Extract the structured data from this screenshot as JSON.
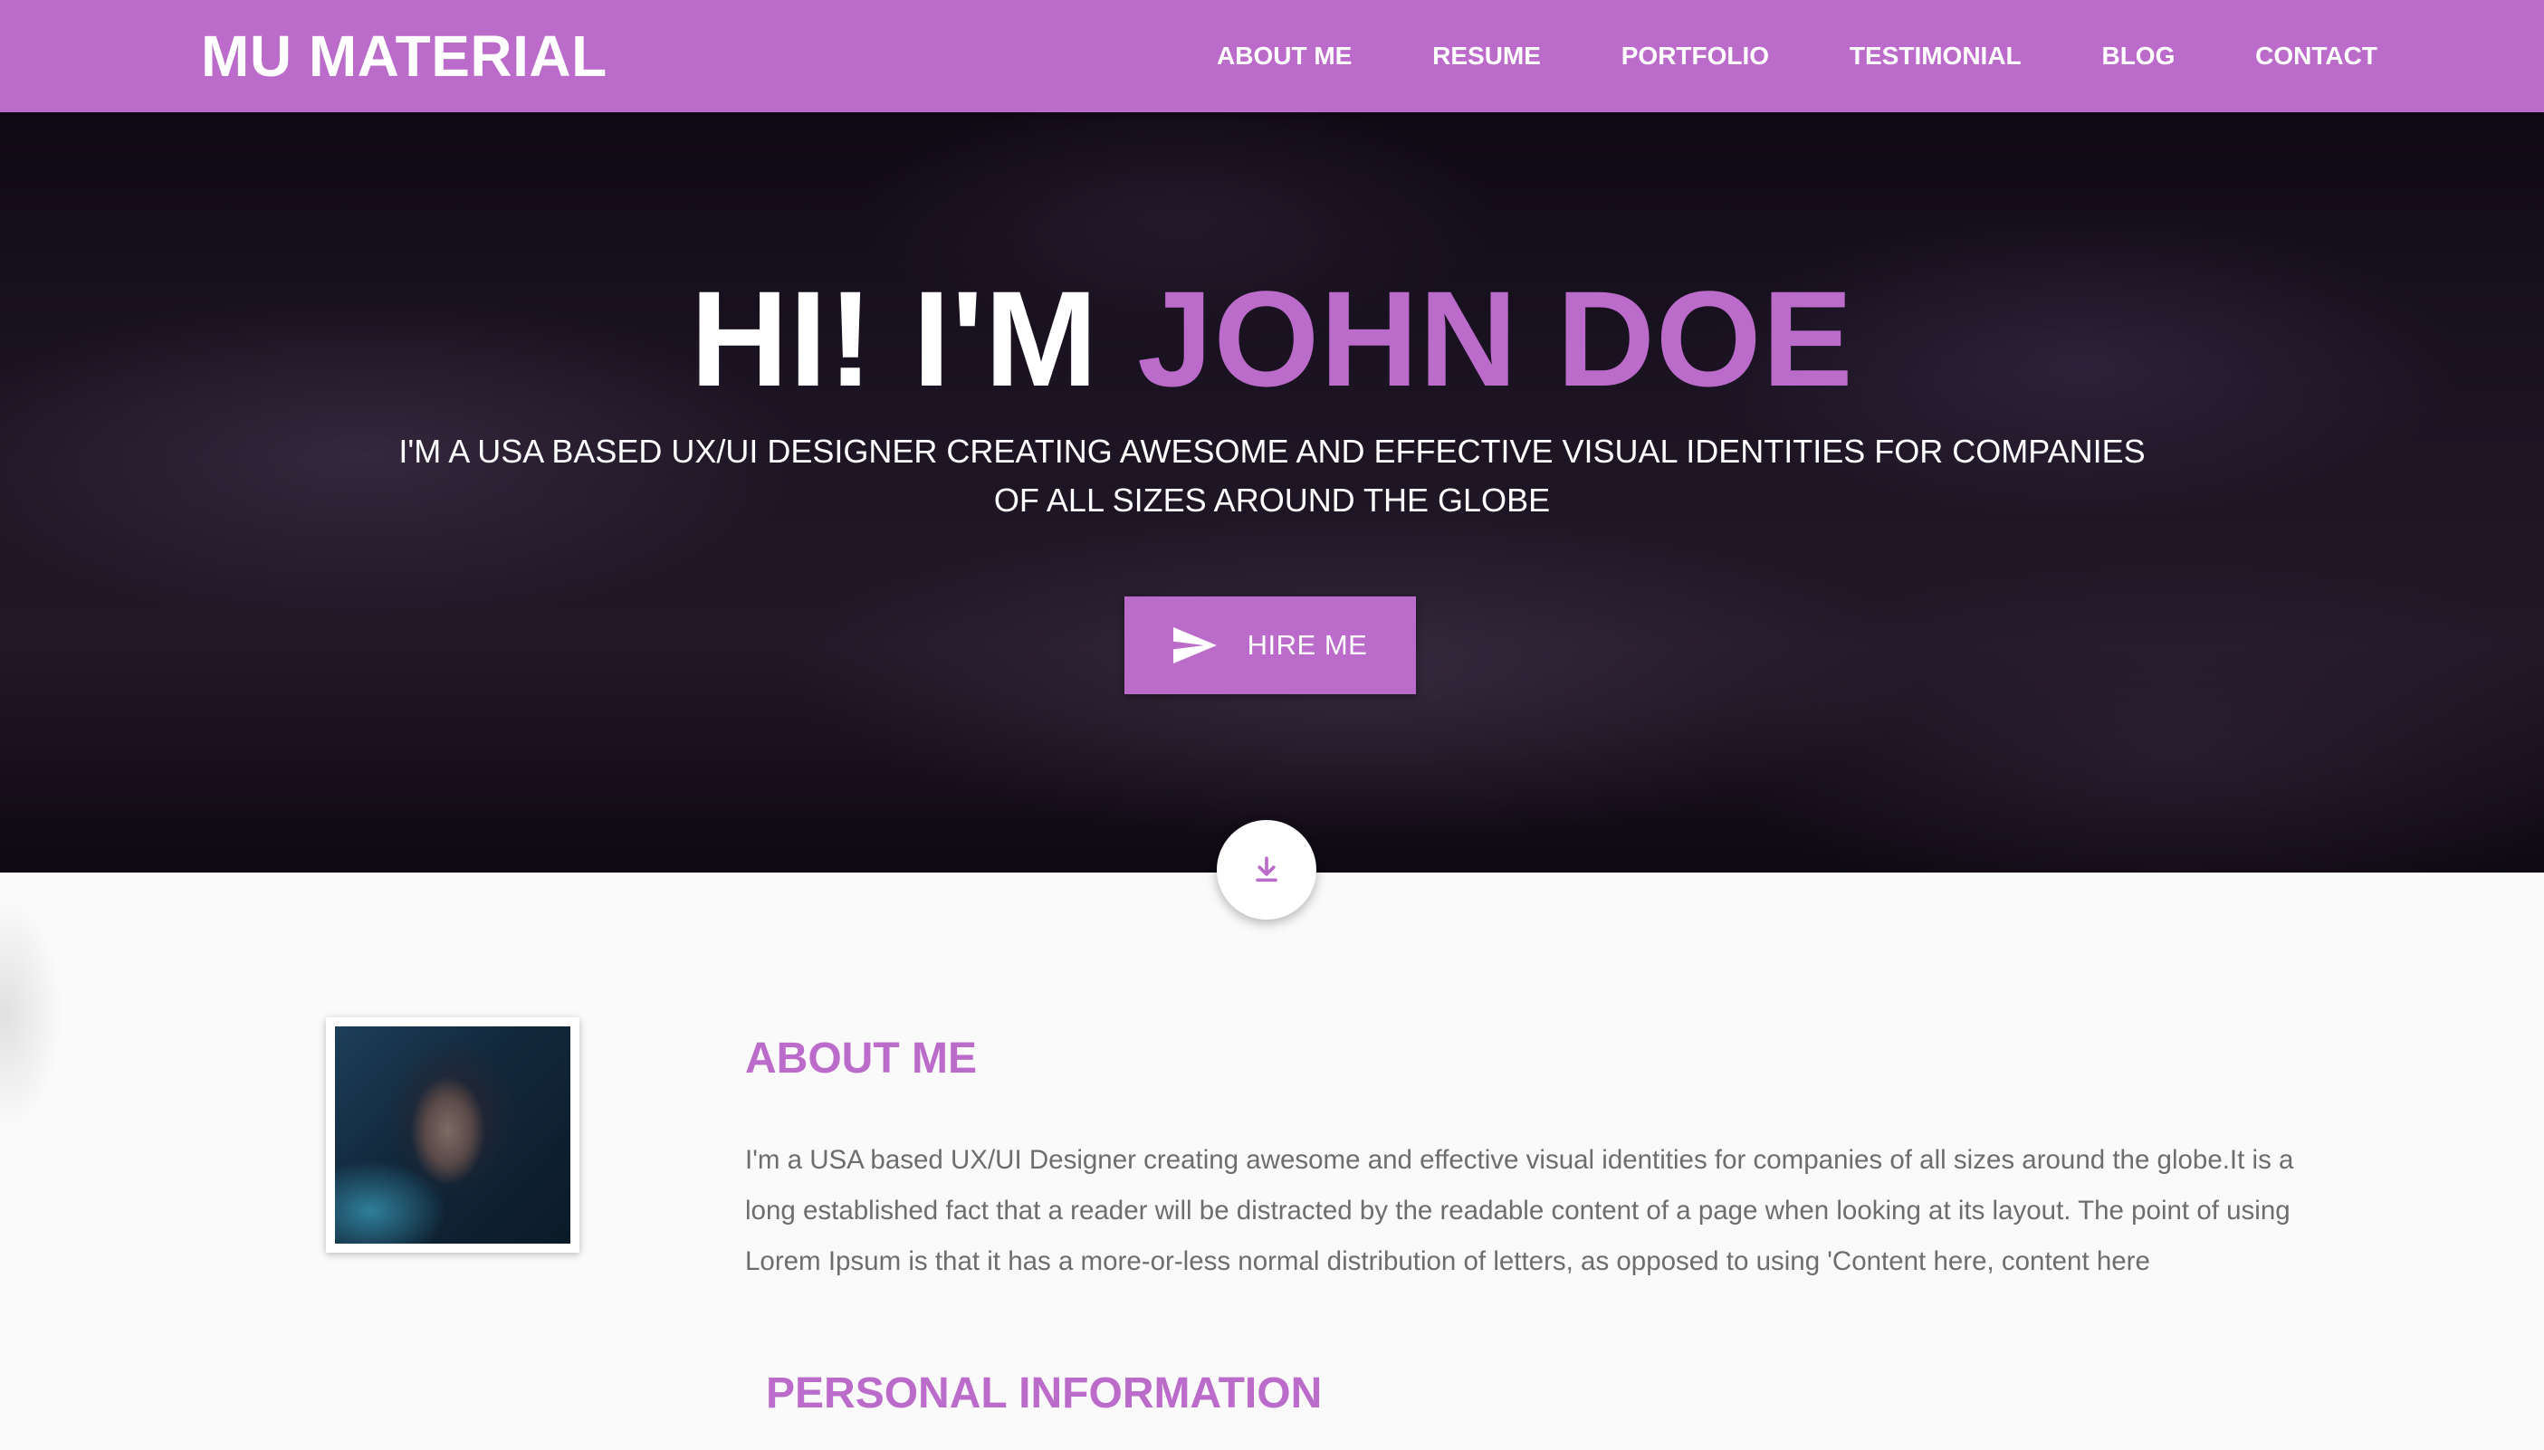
{
  "brand": {
    "name": "MU MATERIAL"
  },
  "nav": {
    "items": [
      {
        "label": "ABOUT ME"
      },
      {
        "label": "RESUME"
      },
      {
        "label": "PORTFOLIO"
      },
      {
        "label": "TESTIMONIAL"
      },
      {
        "label": "BLOG"
      },
      {
        "label": "CONTACT"
      }
    ]
  },
  "hero": {
    "title_prefix": "HI! I'M ",
    "title_name": "JOHN DOE",
    "subtitle": "I'M A USA BASED UX/UI DESIGNER CREATING AWESOME AND EFFECTIVE VISUAL IDENTITIES FOR COMPANIES OF ALL SIZES AROUND THE GLOBE",
    "hire_label": "HIRE ME",
    "hire_icon": "send-icon",
    "scroll_icon": "download-arrow-icon"
  },
  "about": {
    "title": "ABOUT ME",
    "body": "I'm a USA based UX/UI Designer creating awesome and effective visual identities for companies of all sizes around the globe.It is a long established fact that a reader will be distracted by the readable content of a page when looking at its layout. The point of using Lorem Ipsum is that it has a more-or-less normal distribution of letters, as opposed to using 'Content here, content here"
  },
  "personal": {
    "title": "PERSONAL INFORMATION"
  },
  "colors": {
    "accent": "#bb6bc9",
    "hero_text": "#ffffff",
    "body_text": "#6d6d6d",
    "page_bg": "#fafafa"
  }
}
